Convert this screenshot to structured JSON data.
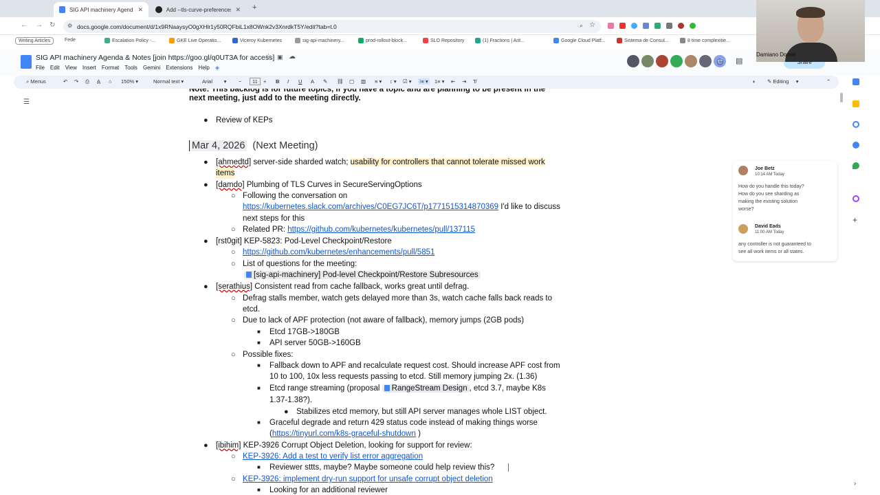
{
  "browser": {
    "tabs": [
      {
        "title": "SIG API machinery Agenda &",
        "active": true
      },
      {
        "title": "Add --tls-curve-preferences",
        "active": false
      }
    ],
    "new_tab": "+",
    "url": "docs.google.com/document/d/1x9RNaaysyO0gXHlr1y50RQFbiL1x8OWnk2v3XnrdkT5Y/edit?tab=t.0",
    "bookmarks": [
      "Writing Articles",
      "Fede",
      "Escalation Policy -...",
      "GKE Live Operatio...",
      "Viceroy Kubernetes",
      "sig-api-machinery...",
      "prod-rollout-block...",
      "SLO Repository",
      "(1) Fractions | Arit...",
      "Google Cloud Platf...",
      "Sistema de Consul...",
      "8 time complexitie..."
    ]
  },
  "doc": {
    "title": "SIG API machinery Agenda & Notes [join https://goo.gl/q0UT3A for access]",
    "menu": [
      "File",
      "Edit",
      "View",
      "Insert",
      "Format",
      "Tools",
      "Gemini",
      "Extensions",
      "Help"
    ],
    "collaborators_more": "+8",
    "share_label": "Share",
    "mode": "Editing",
    "participant_name": "Damiano Donati"
  },
  "toolbar": {
    "menus": "Menus",
    "zoom": "150%",
    "style": "Normal text",
    "font": "Arial",
    "font_size": "11",
    "minus": "−",
    "plus": "+"
  },
  "content": {
    "note_tail": "Note: This backlog is for future topics, if you have a topic and are planning to be present in the",
    "note_line2": "next meeting, just add to the meeting directly.",
    "review_keps": "Review of KEPs",
    "date": "Mar 4, 2026",
    "next_meeting": "(Next Meeting)",
    "item1_user": "[ahmedtd]",
    "item1_text": "server-side sharded watch;",
    "item1_hl": "usability for controllers that cannot tolerate missed work",
    "item1_hl2": "items",
    "item2_user": "[damdo]",
    "item2_text": "Plumbing of TLS Curves in SecureServingOptions",
    "item2_sub1": "Following the conversation on",
    "item2_link1": "https://kubernetes.slack.com/archives/C0EG7JC6T/p1771515314870369",
    "item2_sub1b": "I'd like to discuss",
    "item2_sub1c": "next steps for this",
    "item2_sub2": "Related PR:",
    "item2_link2": "https://github.com/kubernetes/kubernetes/pull/137115",
    "item3": "[rst0git] KEP-5823: Pod-Level Checkpoint/Restore",
    "item3_link": "https://github.com/kubernetes/enhancements/pull/5851",
    "item3_sub2": "List of questions for the meeting:",
    "item3_chip": "[sig-api-machinery] Pod-level Checkpoint/Restore Subresources",
    "item4_user": "[serathius]",
    "item4_text": "Consistent read from cache fallback, works great until defrag.",
    "item4_sub1": "Defrag stalls member, watch gets delayed more than 3s, watch cache falls back reads to",
    "item4_sub1b": "etcd.",
    "item4_sub2": "Due to lack of APF protection (not aware of fallback), memory jumps (2GB pods)",
    "item4_sub2a": "Etcd 17GB->180GB",
    "item4_sub2b": "API server 50GB->160GB",
    "item4_sub3": "Possible fixes:",
    "item4_fix1": "Fallback down to APF and recalculate request cost. Should increase APF cost from",
    "item4_fix1b": "10 to 100, 10x less requests passing to etcd. Still memory jumping 2x. (1.36)",
    "item4_fix2a": "Etcd range streaming (proposal",
    "item4_fix2chip": "RangeStream Design",
    "item4_fix2b": ", etcd 3.7, maybe K8s",
    "item4_fix2c": "1.37-1.38?).",
    "item4_fix2d": "Stabilizes etcd memory, but still API server manages whole LIST object.",
    "item4_fix3": "Graceful degrade and return 429 status code instead of making things worse",
    "item4_fix3b_open": "(",
    "item4_fix3_link": "https://tinyurl.com/k8s-graceful-shutdown",
    "item4_fix3b_close": ")",
    "item5_user": "[ibihim]",
    "item5_text": "KEP-3926 Corrupt Object Deletion, looking for support for review:",
    "item5_link1": "KEP-3926: Add a test to verify list error aggregation",
    "item5_sub1": "Reviewer sttts, maybe? Maybe someone could help review this?",
    "item5_link2": "KEP-3926: implement dry-run support for unsafe corrupt object deletion",
    "item5_sub2": "Looking for an additional reviewer"
  },
  "comments": [
    {
      "author": "Joe Betz",
      "time": "10:14 AM Today",
      "text": [
        "How do you handle this today?",
        "How do you see sharding as",
        "making the existing solution",
        "worse?"
      ]
    },
    {
      "author": "David Eads",
      "time": "11:00 AM Today",
      "text": [
        "any controller is not guaranteed to",
        "see all work items or all states."
      ]
    }
  ]
}
